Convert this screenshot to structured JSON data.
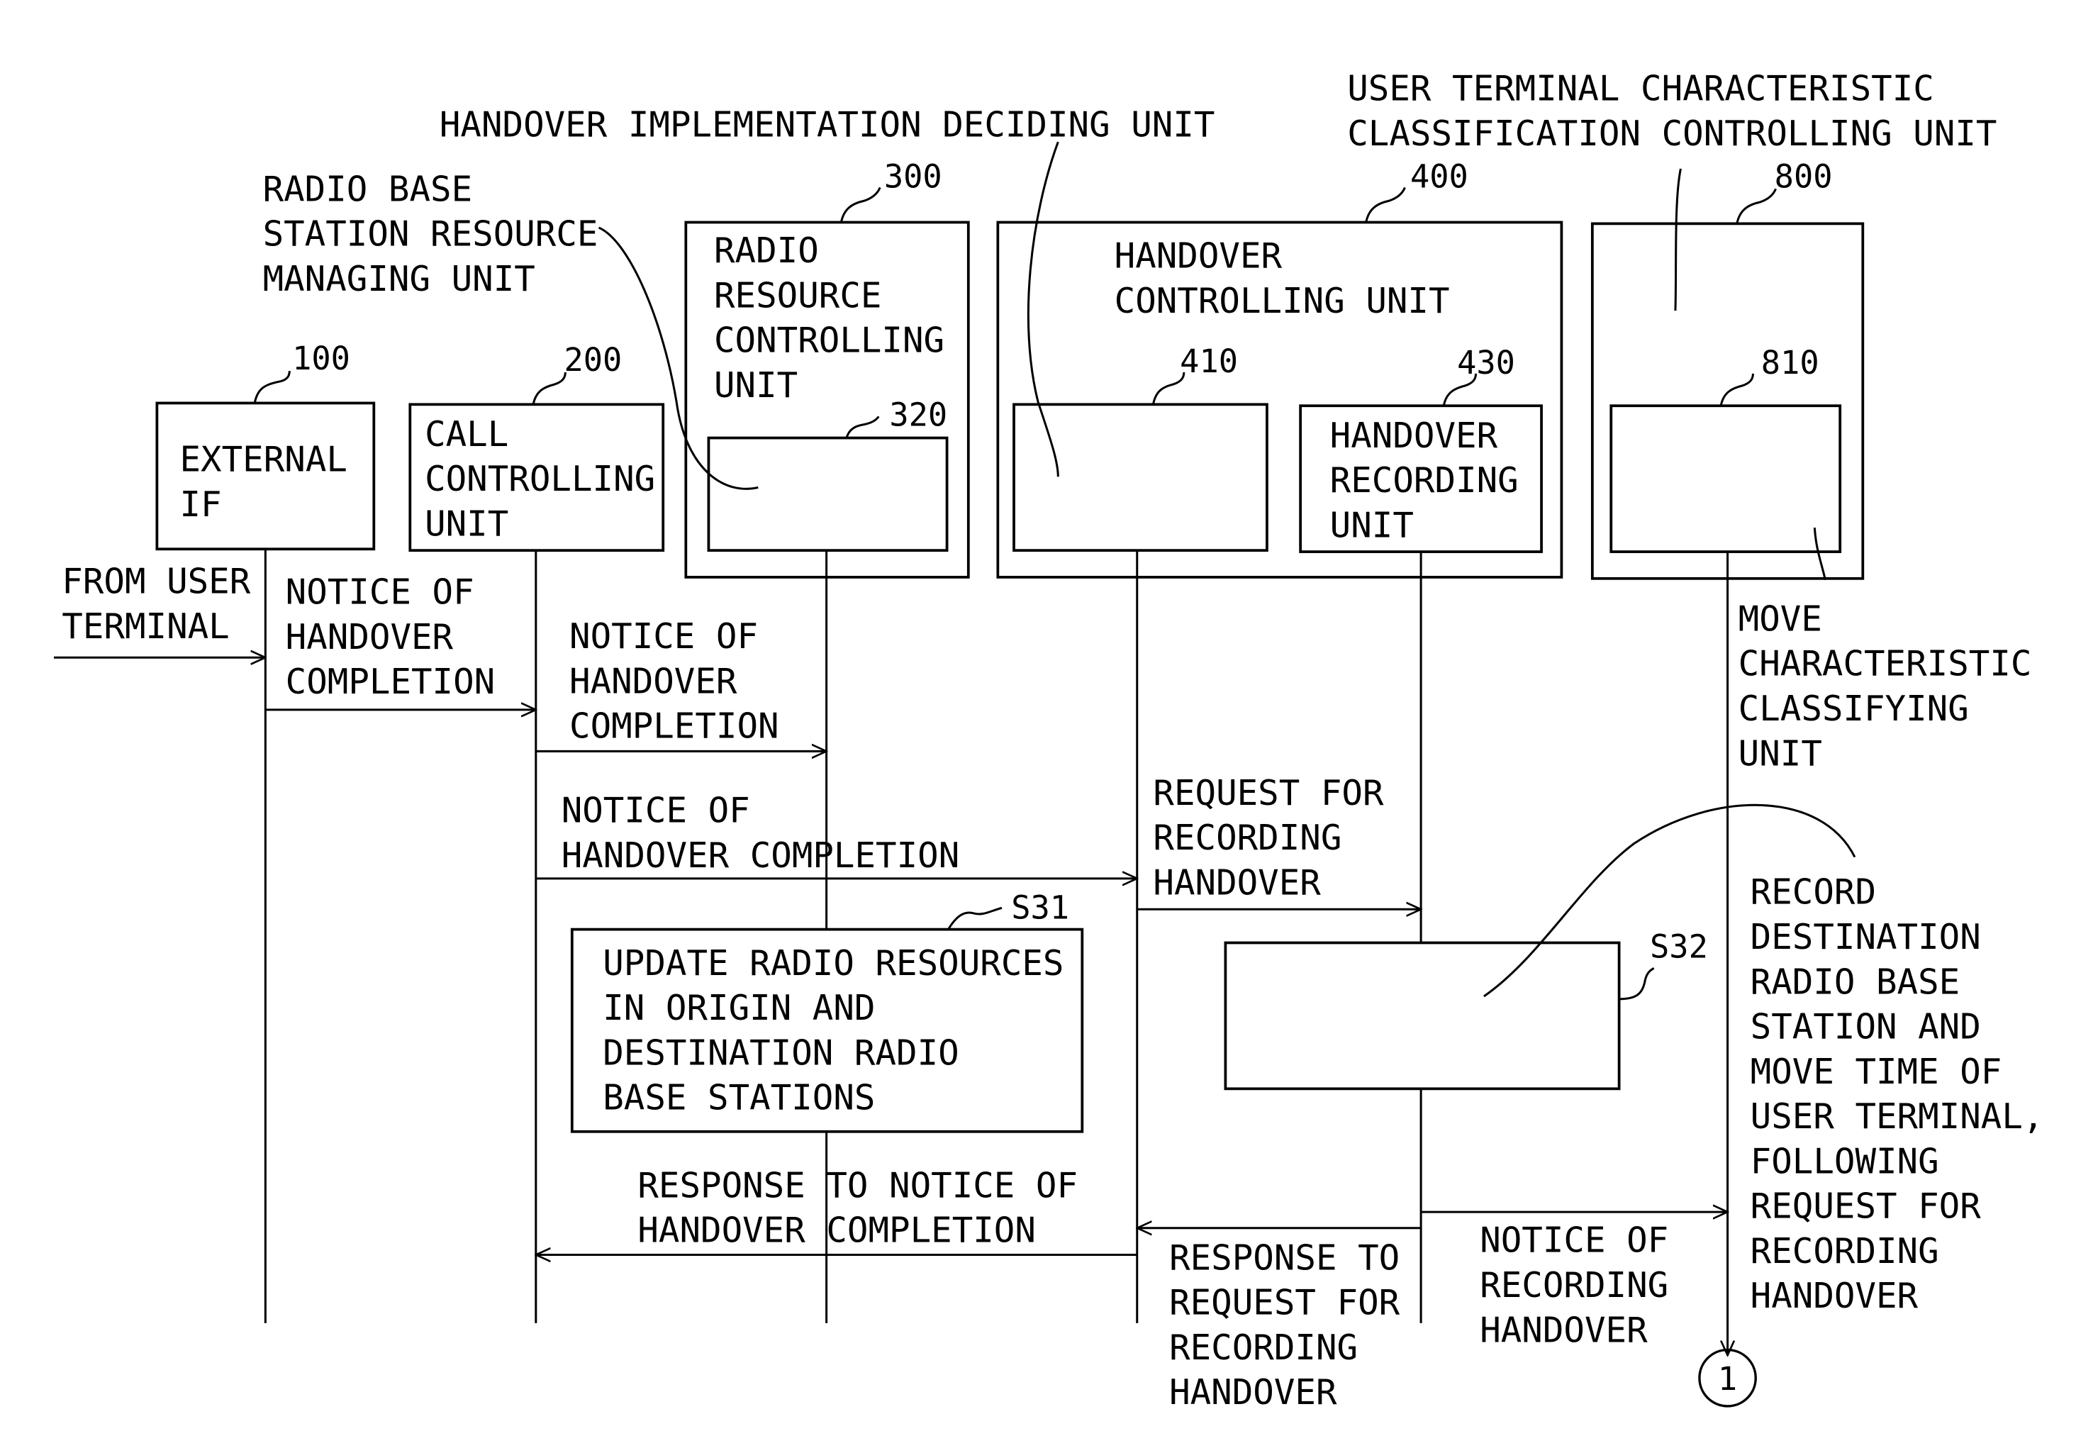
{
  "diagram": {
    "colors": {
      "ink": "#000000",
      "paper": "#ffffff"
    },
    "top_labels": {
      "handover_impl": [
        "HANDOVER IMPLEMENTATION DECIDING UNIT"
      ],
      "utc": [
        "USER TERMINAL CHARACTERISTIC",
        "CLASSIFICATION CONTROLLING UNIT"
      ],
      "rbsrm": [
        "RADIO BASE",
        "STATION RESOURCE",
        "MANAGING UNIT"
      ]
    },
    "units": {
      "u100": {
        "ref": "100",
        "label": [
          "EXTERNAL",
          "IF"
        ]
      },
      "u200": {
        "ref": "200",
        "label": [
          "CALL",
          "CONTROLLING",
          "UNIT"
        ]
      },
      "u300": {
        "ref": "300",
        "label": [
          "RADIO",
          "RESOURCE",
          "CONTROLLING",
          "UNIT"
        ]
      },
      "u320": {
        "ref": "320",
        "label": []
      },
      "u400": {
        "ref": "400",
        "label": [
          "HANDOVER",
          "CONTROLLING UNIT"
        ]
      },
      "u410": {
        "ref": "410",
        "label": []
      },
      "u430": {
        "ref": "430",
        "label": [
          "HANDOVER",
          "RECORDING",
          "UNIT"
        ]
      },
      "u800": {
        "ref": "800",
        "label": []
      },
      "u810": {
        "ref": "810",
        "label": []
      }
    },
    "side_labels": {
      "mccu": [
        "MOVE",
        "CHARACTERISTIC",
        "CLASSIFYING",
        "UNIT"
      ],
      "from_user": [
        "FROM USER",
        "TERMINAL"
      ]
    },
    "messages": {
      "m1": [
        "NOTICE OF",
        "HANDOVER",
        "COMPLETION"
      ],
      "m2": [
        "NOTICE OF",
        "HANDOVER",
        "COMPLETION"
      ],
      "m3": [
        "NOTICE OF",
        "HANDOVER COMPLETION"
      ],
      "m4": [
        "REQUEST FOR",
        "RECORDING",
        "HANDOVER"
      ],
      "m5": [
        "RESPONSE TO NOTICE OF",
        "HANDOVER COMPLETION"
      ],
      "m6": [
        "RESPONSE TO",
        "REQUEST FOR",
        "RECORDING",
        "HANDOVER"
      ],
      "m7": [
        "NOTICE OF",
        "RECORDING",
        "HANDOVER"
      ]
    },
    "steps": {
      "s31": {
        "ref": "S31",
        "label": [
          "UPDATE RADIO RESOURCES",
          "IN ORIGIN AND",
          "DESTINATION RADIO",
          "BASE STATIONS"
        ]
      },
      "s32": {
        "ref": "S32",
        "label": [],
        "callout": [
          "RECORD",
          "DESTINATION",
          "RADIO BASE",
          "STATION AND",
          "MOVE TIME OF",
          "USER TERMINAL,",
          "FOLLOWING",
          "REQUEST FOR",
          "RECORDING",
          "HANDOVER"
        ]
      }
    },
    "connector": "1"
  }
}
